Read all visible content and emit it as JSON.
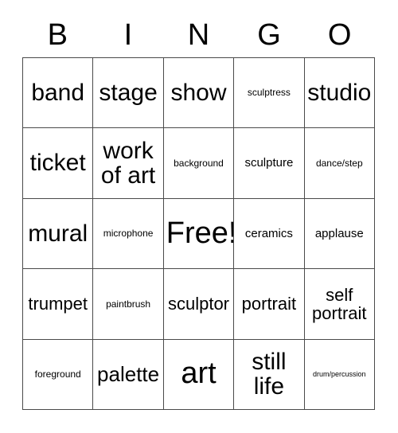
{
  "header": {
    "letters": [
      "B",
      "I",
      "N",
      "G",
      "O"
    ]
  },
  "grid": {
    "rows": 5,
    "columns": 5,
    "border_color": "#4a4a4a",
    "background_color": "#ffffff",
    "text_color": "#000000",
    "cells": [
      [
        {
          "label": "band",
          "size": "xl"
        },
        {
          "label": "stage",
          "size": "xl"
        },
        {
          "label": "show",
          "size": "xl"
        },
        {
          "label": "sculptress",
          "size": "xs"
        },
        {
          "label": "studio",
          "size": "xl"
        }
      ],
      [
        {
          "label": "ticket",
          "size": "xl"
        },
        {
          "label": "work\nof art",
          "size": "xl"
        },
        {
          "label": "background",
          "size": "xs"
        },
        {
          "label": "sculpture",
          "size": "sm"
        },
        {
          "label": "dance/step",
          "size": "xs"
        }
      ],
      [
        {
          "label": "mural",
          "size": "xl"
        },
        {
          "label": "microphone",
          "size": "xs"
        },
        {
          "label": "Free!",
          "size": "xxl"
        },
        {
          "label": "ceramics",
          "size": "sm"
        },
        {
          "label": "applause",
          "size": "sm"
        }
      ],
      [
        {
          "label": "trumpet",
          "size": "md"
        },
        {
          "label": "paintbrush",
          "size": "xs"
        },
        {
          "label": "sculptor",
          "size": "md"
        },
        {
          "label": "portrait",
          "size": "md"
        },
        {
          "label": "self\nportrait",
          "size": "md"
        }
      ],
      [
        {
          "label": "foreground",
          "size": "xs"
        },
        {
          "label": "palette",
          "size": "lg"
        },
        {
          "label": "art",
          "size": "xxl"
        },
        {
          "label": "still\nlife",
          "size": "xl"
        },
        {
          "label": "drum/percussion",
          "size": "xxs"
        }
      ]
    ]
  }
}
